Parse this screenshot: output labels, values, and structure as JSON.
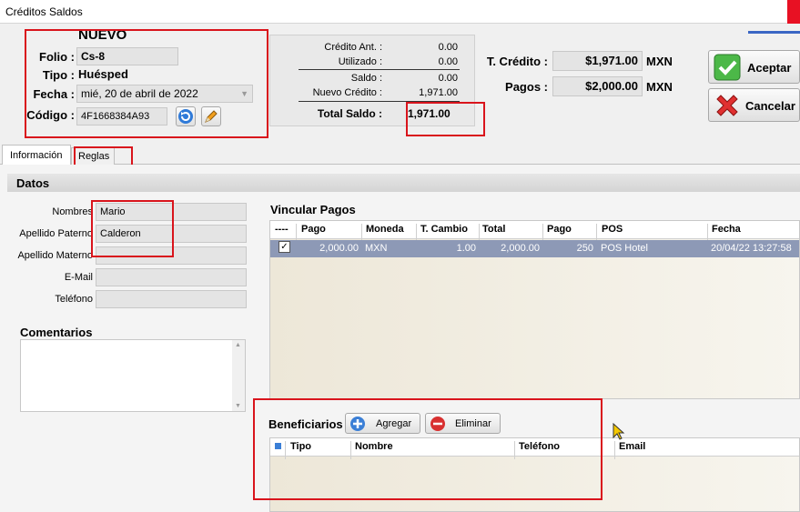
{
  "window": {
    "title": "Créditos Saldos"
  },
  "header": {
    "status": "NUEVO",
    "folio_label": "Folio :",
    "folio_value": "Cs-8",
    "tipo_label": "Tipo :",
    "tipo_value": "Huésped",
    "fecha_label": "Fecha :",
    "fecha_value": "mié, 20 de abril de 2022",
    "codigo_label": "Código :",
    "codigo_value": "4F1668384A93"
  },
  "summary": {
    "credito_ant_label": "Crédito Ant. :",
    "credito_ant_value": "0.00",
    "utilizado_label": "Utilizado :",
    "utilizado_value": "0.00",
    "saldo_label": "Saldo :",
    "saldo_value": "0.00",
    "nuevo_credito_label": "Nuevo Crédito :",
    "nuevo_credito_value": "1,971.00",
    "total_saldo_label": "Total Saldo :",
    "total_saldo_value": "1,971.00"
  },
  "totals": {
    "credito_label": "T. Crédito :",
    "credito_value": "$1,971.00",
    "credito_currency": "MXN",
    "pagos_label": "Pagos :",
    "pagos_value": "$2,000.00",
    "pagos_currency": "MXN"
  },
  "actions": {
    "accept": "Aceptar",
    "cancel": "Cancelar"
  },
  "tabs": [
    "Información",
    "Reglas"
  ],
  "datos": {
    "title": "Datos",
    "nombres_label": "Nombres",
    "nombres_value": "Mario",
    "paterno_label": "Apellido Paterno",
    "paterno_value": "Calderon",
    "materno_label": "Apellido Materno",
    "materno_value": "",
    "email_label": "E-Mail",
    "email_value": "",
    "telefono_label": "Teléfono",
    "telefono_value": "",
    "comentarios_label": "Comentarios"
  },
  "pagos_grid": {
    "title": "Vincular Pagos",
    "columns": [
      "----",
      "Pago",
      "Moneda",
      "T. Cambio",
      "Total",
      "Pago",
      "POS",
      "Fecha"
    ],
    "rows": [
      {
        "checked": "✓",
        "pago": "2,000.00",
        "moneda": "MXN",
        "t_cambio": "1.00",
        "total": "2,000.00",
        "pago2": "250",
        "pos": "POS Hotel",
        "fecha": "20/04/22 13:27:58"
      }
    ]
  },
  "beneficiarios": {
    "title": "Beneficiarios",
    "add": "Agregar",
    "remove": "Eliminar",
    "columns": [
      "Tipo",
      "Nombre",
      "Teléfono",
      "Email"
    ]
  }
}
